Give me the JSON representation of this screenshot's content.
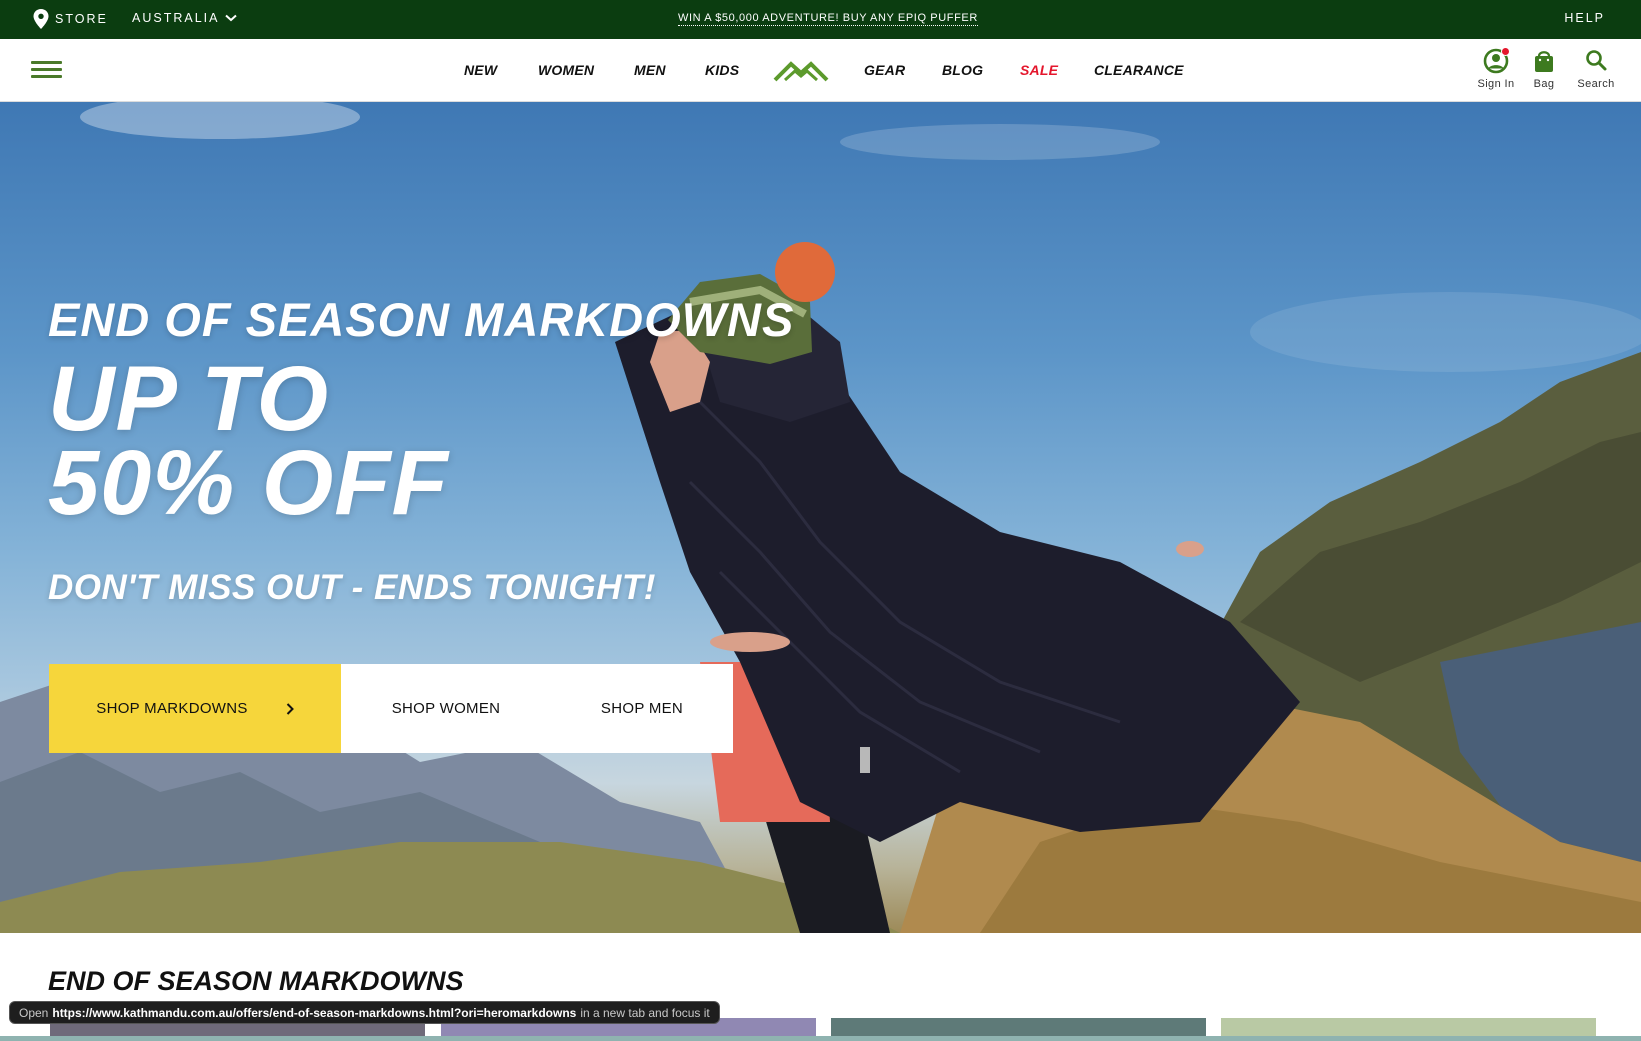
{
  "topbar": {
    "store_label": "STORE",
    "country_label": "AUSTRALIA",
    "promo_text": "WIN A $50,000 ADVENTURE! BUY ANY EPIQ PUFFER",
    "help_label": "HELP",
    "background": "#0b3d10"
  },
  "nav": {
    "items": [
      {
        "label": "NEW"
      },
      {
        "label": "WOMEN"
      },
      {
        "label": "MEN"
      },
      {
        "label": "KIDS"
      },
      {
        "label": "GEAR"
      },
      {
        "label": "BLOG"
      },
      {
        "label": "SALE",
        "color": "#e4162c"
      },
      {
        "label": "CLEARANCE"
      }
    ],
    "logo_icon": "mountain-logo-icon",
    "accent_color": "#4a7a2a"
  },
  "header_icons": {
    "sign_in": {
      "label": "Sign In",
      "icon": "user-icon"
    },
    "bag": {
      "label": "Bag",
      "icon": "bag-icon"
    },
    "search": {
      "label": "Search",
      "icon": "search-icon"
    }
  },
  "hero": {
    "title": "END OF SEASON MARKDOWNS",
    "headline_line1": "UP TO",
    "headline_line2": "50% OFF",
    "subtitle": "DON'T MISS OUT - ENDS TONIGHT!",
    "cta_primary": "SHOP MARKDOWNS",
    "cta_women": "SHOP WOMEN",
    "cta_men": "SHOP MEN",
    "cta_primary_color": "#f6d63b"
  },
  "section": {
    "title": "END OF SEASON MARKDOWNS"
  },
  "status": {
    "prefix": "Open",
    "url": "https://www.kathmandu.com.au/offers/end-of-season-markdowns.html?ori=heromarkdowns",
    "suffix": "in a new tab and focus it"
  }
}
